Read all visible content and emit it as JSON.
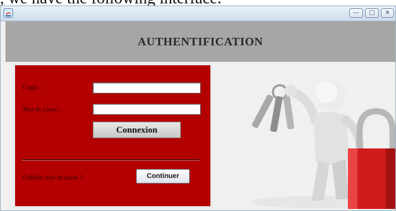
{
  "doc_text": ", we have the following interface:",
  "window": {
    "controls": {
      "minimize": "—",
      "maximize": "□",
      "close": "✕"
    },
    "header_title": "AUTHENTIFICATION"
  },
  "form": {
    "login_label": "Login :",
    "password_label": "Mot de passe :",
    "login_value": "",
    "password_value": "",
    "connect_button": "Connexion",
    "forgot_label": "Oubliez mot de passe ?",
    "continue_button": "Continuer"
  },
  "illustration": {
    "icons": [
      "figure-with-keys-icon",
      "padlock-icon"
    ]
  },
  "colors": {
    "panel": "#b30000",
    "header": "#a6a6a6",
    "lock": "#d11b1b"
  }
}
